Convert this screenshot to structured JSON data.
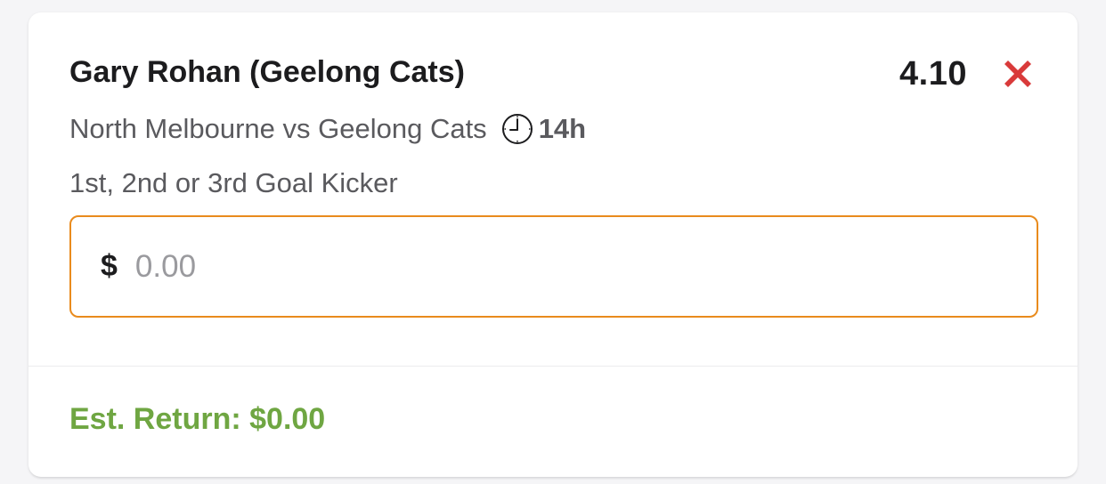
{
  "bet_slip": {
    "selection": "Gary Rohan (Geelong Cats)",
    "odds": "4.10",
    "remove_icon": "red-x-icon",
    "event": "North Melbourne vs Geelong Cats",
    "clock_icon": "clock-icon",
    "time_until": "14h",
    "market": "1st, 2nd or 3rd Goal Kicker",
    "stake": {
      "currency_symbol": "$",
      "value": "",
      "placeholder": "0.00"
    },
    "est_return": "Est. Return: $0.00"
  },
  "colors": {
    "input_border": "#e98b1d",
    "remove_icon": "#d93a3a",
    "est_return": "#6fa642"
  }
}
